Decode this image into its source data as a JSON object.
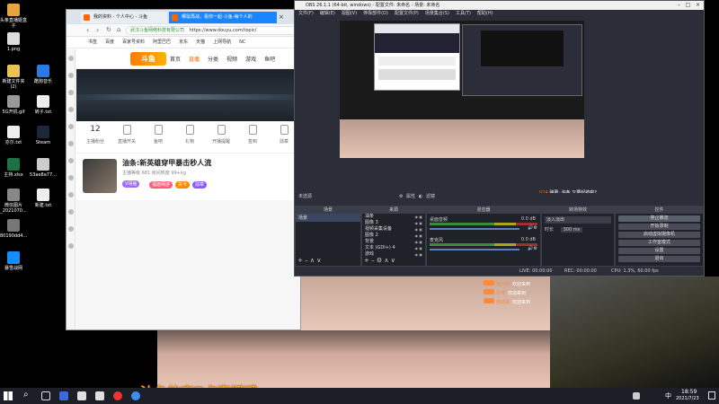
{
  "desktop": {
    "icons": [
      {
        "label": "头条直播姬盒子",
        "color": "#e7a33e"
      },
      {
        "label": "1.png",
        "color": "#ddd"
      },
      {
        "label": "新建文件夹(2)",
        "color": "#e8c35a"
      },
      {
        "label": "酷狗音乐",
        "color": "#2a7ae2"
      },
      {
        "label": "5G开机.gif",
        "color": "#999"
      },
      {
        "label": "转子.txt",
        "color": "#eee"
      },
      {
        "label": "亦尔.txt",
        "color": "#eee"
      },
      {
        "label": "Steam",
        "color": "#1b2838"
      },
      {
        "label": "主持.xlsx",
        "color": "#1e7145"
      },
      {
        "label": "53ae8a77...",
        "color": "#ccc"
      },
      {
        "label": "微信图片_2021070...",
        "color": "#888"
      },
      {
        "label": "新建.txt",
        "color": "#eee"
      },
      {
        "label": "80190dd4...",
        "color": "#777"
      },
      {
        "label": "暴雪战网",
        "color": "#148eff"
      }
    ]
  },
  "browser": {
    "tabs": [
      {
        "label": "我的资料 - 个人中心 - 斗鱼",
        "color": "#f60"
      },
      {
        "label": "哪鼠再战，看你一起-斗鱼-每个人的",
        "color": "#f60"
      }
    ],
    "address": "https://www.douyu.com/topic/",
    "secure_label": "武汉斗鱼网络科技有限公司",
    "bookmarks": [
      "书签",
      "百度",
      "百家号资料",
      "阿里巴巴",
      "京东",
      "天猫",
      "上网导航",
      "NC"
    ],
    "site_nav": [
      "首页",
      "直播",
      "分类",
      "视频",
      "游戏",
      "鱼吧"
    ],
    "logo_text": "斗鱼",
    "user_stats": [
      {
        "value": "12",
        "label": "主播粉丝"
      },
      {
        "value": "",
        "label": "直播开关"
      },
      {
        "value": "",
        "label": "鱼吧"
      },
      {
        "value": "",
        "label": "礼物"
      },
      {
        "value": "",
        "label": "开播提醒"
      },
      {
        "value": "",
        "label": "签到"
      },
      {
        "value": "",
        "label": "勋章"
      }
    ],
    "room": {
      "title": "油条:新英雄穿甲暴击秒人流",
      "level_badge": "V领袖",
      "tags": [
        "福建网游",
        "关卡",
        "勋章"
      ],
      "streamer": "油条",
      "sub_line": "主播等级 681 房间热度 99+kg",
      "follow_tag": "公告"
    }
  },
  "obs": {
    "title": "OBS 26.1.1 (64-bit, windows) - 配置文件: 未命名 - 场景: 未命名",
    "menu": [
      "文件(F)",
      "编辑(E)",
      "视图(V)",
      "停靠部件(D)",
      "配置文件(P)",
      "场景集合(S)",
      "工具(T)",
      "帮助(H)"
    ],
    "toolbar_source": "未选源",
    "toolbar_props": "属性",
    "toolbar_filter": "滤镜",
    "panels": {
      "scenes": "场景",
      "sources": "来源",
      "mixer": "混音器",
      "transitions": "转场特效",
      "controls": "控件"
    },
    "scene_items": [
      "场景"
    ],
    "source_items": [
      "油条",
      "图像 3",
      "视频采集设备",
      "图像 2",
      "背景",
      "文本 (GDI+) 4",
      "游戏"
    ],
    "mixer": [
      {
        "name": "桌面音频",
        "db": "0.0 dB"
      },
      {
        "name": "麦克风",
        "db": "0.0 dB"
      }
    ],
    "transition_value": "淡入淡出",
    "duration_label": "时长",
    "duration_value": "300 ms",
    "control_buttons": [
      "停止推流",
      "开始录制",
      "启动虚拟摄像机",
      "工作室模式",
      "设置",
      "退出"
    ],
    "status": {
      "live": "LIVE: 00:00:00",
      "rec": "REC: 00:00:00",
      "cpu": "CPU: 1.3%, 60.00 fps"
    }
  },
  "stream": {
    "overlay_text": "油条的夜7点直播哦",
    "danmaku_name": "V24",
    "danmaku_text": "弹幕: 油条 又要起航啦?",
    "chat": [
      {
        "name": "迷人的",
        "text": "欢迎来到"
      },
      {
        "name": "冷锋",
        "text": "欢迎来到"
      },
      {
        "name": "自动看",
        "text": "欢迎来到"
      }
    ]
  },
  "taskbar": {
    "time": "18:59",
    "date": "2021/7/23",
    "lang": "中"
  }
}
